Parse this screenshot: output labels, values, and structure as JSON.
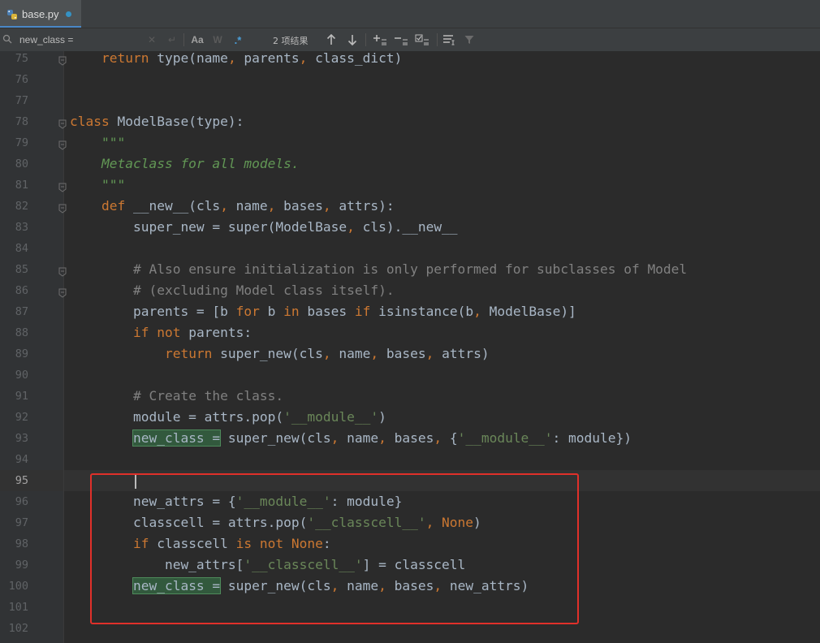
{
  "tab": {
    "filename": "base.py",
    "icon": "python-file-icon"
  },
  "search": {
    "query": "new_class =",
    "result_count": "2 项结果",
    "match_case_label": "Aa",
    "words_label": "W",
    "regex_label": ".*"
  },
  "lines": [
    {
      "n": "75",
      "html": "    <span class=\"kw\">return</span> type(name<span class=\"kw\">,</span> parents<span class=\"kw\">,</span> class_dict)"
    },
    {
      "n": "76",
      "html": ""
    },
    {
      "n": "77",
      "html": ""
    },
    {
      "n": "78",
      "html": "<span class=\"kw\">class</span> ModelBase(type):"
    },
    {
      "n": "79",
      "html": "    <span class=\"doc\">\"\"\"</span>"
    },
    {
      "n": "80",
      "html": "    <span class=\"doc\">Metaclass for all models.</span>"
    },
    {
      "n": "81",
      "html": "    <span class=\"doc\">\"\"\"</span>"
    },
    {
      "n": "82",
      "html": "    <span class=\"kw\">def</span> __new__(cls<span class=\"kw\">,</span> name<span class=\"kw\">,</span> bases<span class=\"kw\">,</span> attrs):"
    },
    {
      "n": "83",
      "html": "        super_new = super(ModelBase<span class=\"kw\">,</span> cls).__new__"
    },
    {
      "n": "84",
      "html": ""
    },
    {
      "n": "85",
      "html": "        <span class=\"cmt\"># Also ensure initialization is only performed for subclasses of Model</span>"
    },
    {
      "n": "86",
      "html": "        <span class=\"cmt\"># (excluding Model class itself).</span>"
    },
    {
      "n": "87",
      "html": "        parents = [b <span class=\"kw\">for</span> b <span class=\"kw\">in</span> bases <span class=\"kw\">if</span> isinstance(b<span class=\"kw\">,</span> ModelBase)]"
    },
    {
      "n": "88",
      "html": "        <span class=\"kw\">if not</span> parents:"
    },
    {
      "n": "89",
      "html": "            <span class=\"kw\">return</span> super_new(cls<span class=\"kw\">,</span> name<span class=\"kw\">,</span> bases<span class=\"kw\">,</span> attrs)"
    },
    {
      "n": "90",
      "html": ""
    },
    {
      "n": "91",
      "html": "        <span class=\"cmt\"># Create the class.</span>"
    },
    {
      "n": "92",
      "html": "        module = attrs.pop(<span class=\"str\">'__module__'</span>)"
    },
    {
      "n": "93",
      "html": "        <span class=\"match\">new_class =</span> super_new(cls<span class=\"kw\">,</span> name<span class=\"kw\">,</span> bases<span class=\"kw\">,</span> {<span class=\"str\">'__module__'</span>: module})"
    },
    {
      "n": "94",
      "html": ""
    },
    {
      "n": "95",
      "html": ""
    },
    {
      "n": "96",
      "html": "        new_attrs = {<span class=\"str\">'__module__'</span>: module}"
    },
    {
      "n": "97",
      "html": "        classcell = attrs.pop(<span class=\"str\">'__classcell__'</span><span class=\"kw\">, None</span>)"
    },
    {
      "n": "98",
      "html": "        <span class=\"kw\">if</span> classcell <span class=\"kw\">is not None</span>:"
    },
    {
      "n": "99",
      "html": "            new_attrs[<span class=\"str\">'__classcell__'</span>] = classcell"
    },
    {
      "n": "100",
      "html": "        <span class=\"match\">new_class =</span> super_new(cls<span class=\"kw\">,</span> name<span class=\"kw\">,</span> bases<span class=\"kw\">,</span> new_attrs)"
    },
    {
      "n": "101",
      "html": ""
    },
    {
      "n": "102",
      "html": ""
    }
  ],
  "current_line": "95",
  "fold_markers": [
    "75",
    "78",
    "79",
    "81",
    "82",
    "85",
    "86"
  ],
  "colors": {
    "keyword": "#cc7832",
    "string": "#6a8759",
    "docstring": "#629755",
    "comment": "#808080",
    "annotation_box": "#e0302a"
  }
}
